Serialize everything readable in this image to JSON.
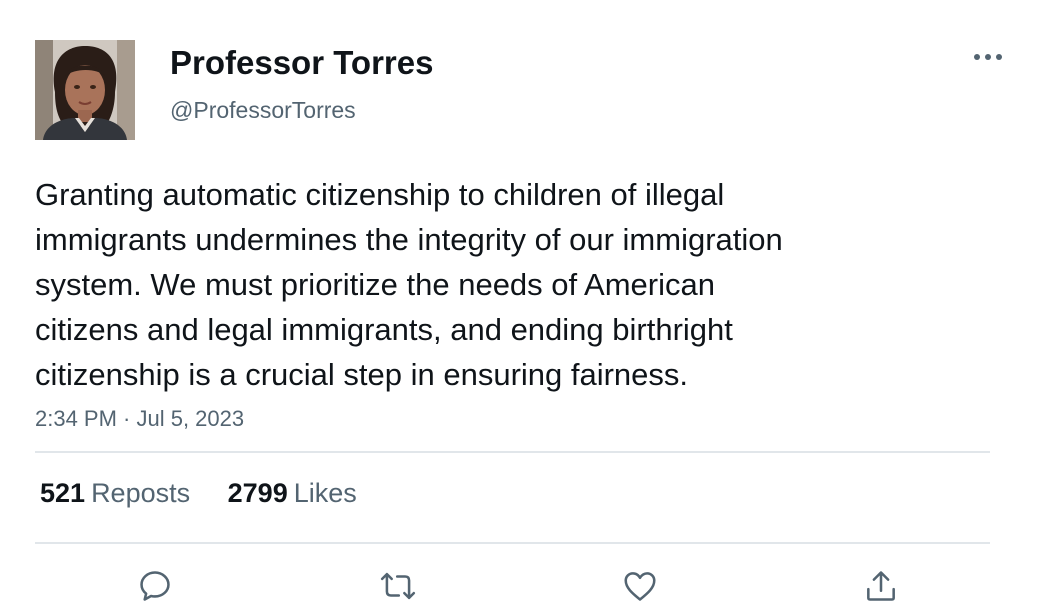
{
  "tweet": {
    "author": {
      "name": "Professor Torres",
      "handle": "@ProfessorTorres",
      "avatar_icon": "profile-photo"
    },
    "text_lines": [
      "Granting automatic citizenship to children of illegal",
      "immigrants undermines the integrity of our immigration",
      "system. We must prioritize the needs of American",
      "citizens and legal immigrants, and ending birthright",
      "citizenship is a crucial step in ensuring fairness."
    ],
    "timestamp": "2:34 PM · Jul 5, 2023",
    "stats": {
      "reposts_count": "521",
      "reposts_label": "Reposts",
      "likes_count": "2799",
      "likes_label": "Likes"
    },
    "actions": [
      "reply-icon",
      "repost-icon",
      "like-icon",
      "share-icon"
    ],
    "more_icon": "more-horizontal-icon"
  },
  "colors": {
    "text_primary": "#0f1419",
    "text_secondary": "#536471",
    "divider": "#e1e6ea",
    "icon": "#536471"
  }
}
